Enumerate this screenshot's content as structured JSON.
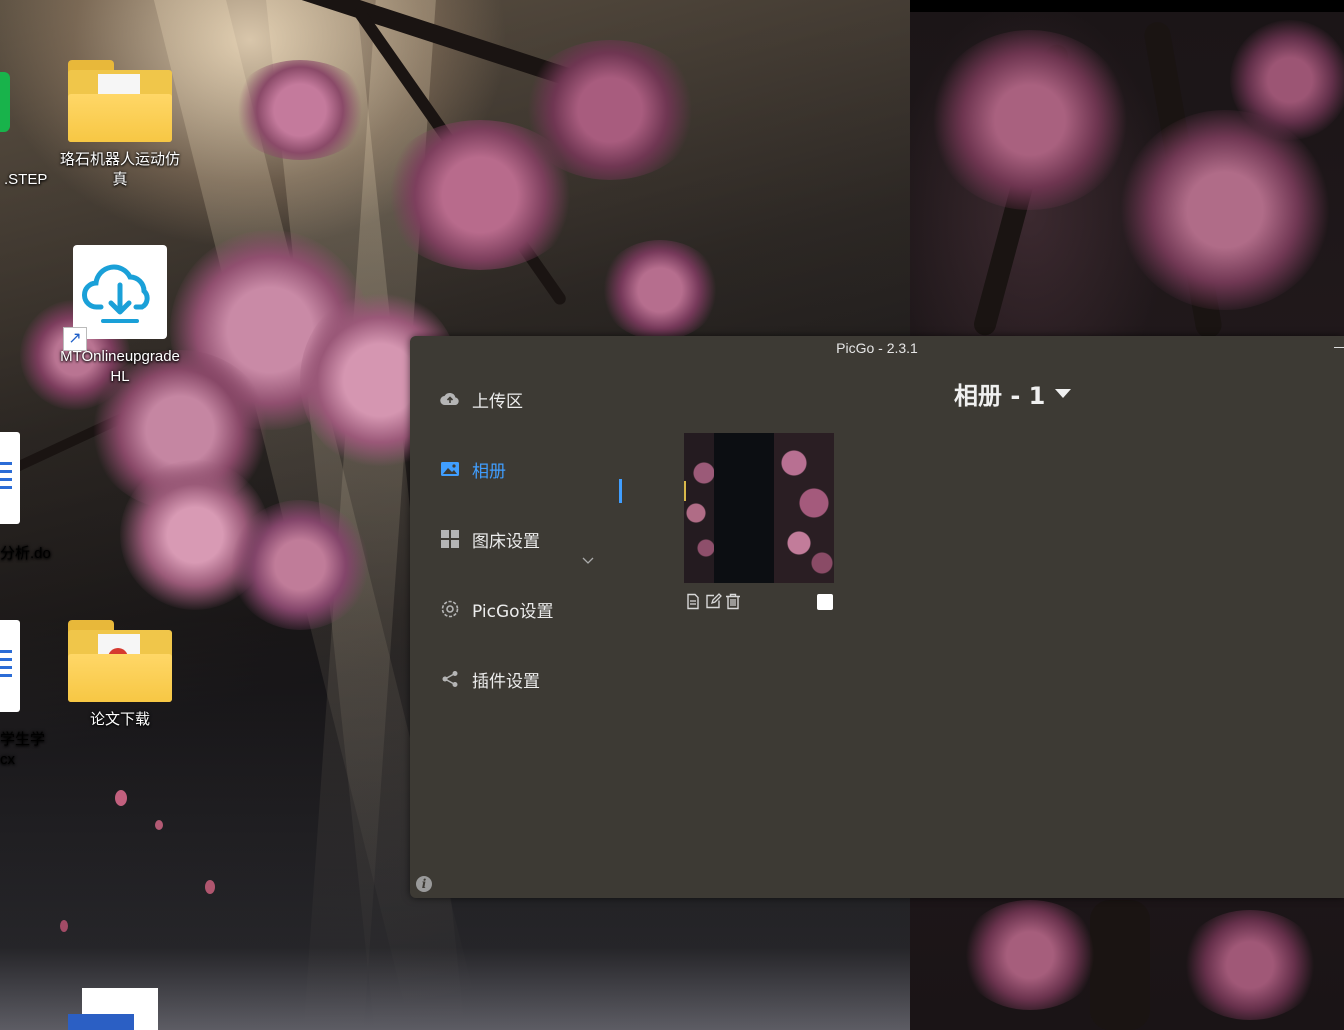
{
  "desktop": {
    "icons": [
      {
        "label": ".STEP"
      },
      {
        "label": "珞石机器人运动仿真"
      },
      {
        "label": "MTOnlineupgradeHL"
      },
      {
        "label": "分析.do"
      },
      {
        "label": "学生学"
      },
      {
        "label": "cx"
      },
      {
        "label": "论文下载"
      }
    ]
  },
  "window": {
    "title": "PicGo - 2.3.1",
    "nav": [
      {
        "label": "上传区",
        "icon": "cloud-upload-icon"
      },
      {
        "label": "相册",
        "icon": "picture-icon",
        "active": true
      },
      {
        "label": "图床设置",
        "icon": "grid-icon"
      },
      {
        "label": "PicGo设置",
        "icon": "gear-icon"
      },
      {
        "label": "插件设置",
        "icon": "share-icon"
      }
    ],
    "gallery": {
      "title": "相册 - 1"
    },
    "colors": {
      "background": "#3d3a34",
      "accent": "#409eff"
    }
  }
}
